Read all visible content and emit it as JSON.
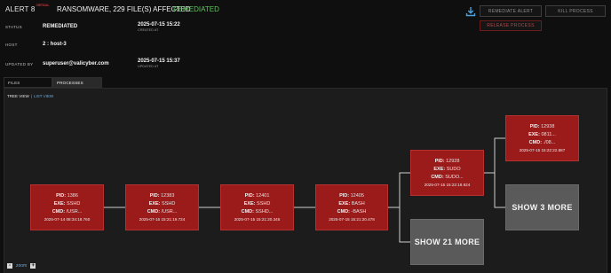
{
  "alert": {
    "id": "ALERT 8",
    "severity": "CRITICAL",
    "title": "RANSOMWARE, 229 FILE(S) AFFECTED",
    "status": "REMEDIATED"
  },
  "details": {
    "status_label": "STATUS",
    "status_value": "REMEDIATED",
    "created_value": "2025-07-15 15:22",
    "created_label": "CREATED AT",
    "host_label": "HOST",
    "host_value": "2 : host-3",
    "updated_by_label": "UPDATED BY",
    "updated_by_value": "superuser@valicyber.com",
    "updated_value": "2025-07-15 15:37",
    "updated_label": "UPDATED AT"
  },
  "toolbar": {
    "download_icon": "download-icon",
    "remediate_label": "REMEDIATE ALERT",
    "kill_label": "KILL PROCESS",
    "release_label": "RELEASE PROCESS"
  },
  "tabs": [
    {
      "label": "FILES",
      "active": false
    },
    {
      "label": "PROCESSES",
      "active": true
    }
  ],
  "view": {
    "tree": "TREE VIEW",
    "separator": "|",
    "list": "LIST VIEW"
  },
  "keys": {
    "pid": "PID:",
    "exe": "EXE:",
    "cmd": "CMD:"
  },
  "nodes": [
    {
      "pid": "1386",
      "exe": "SSHD",
      "cmd": "/USR...",
      "ts": "2025-07-14 08:34:18.760"
    },
    {
      "pid": "12383",
      "exe": "SSHD",
      "cmd": "/USR...",
      "ts": "2025-07-15 15:21:19.724"
    },
    {
      "pid": "12401",
      "exe": "SSHD",
      "cmd": "SSHD...",
      "ts": "2025-07-15 15:21:20.345"
    },
    {
      "pid": "12405",
      "exe": "BASH",
      "cmd": "-BASH",
      "ts": "2025-07-15 15:21:20.478"
    },
    {
      "pid": "12928",
      "exe": "SUDO",
      "cmd": "SUDO...",
      "ts": "2025-07-15 15:22:18.924"
    },
    {
      "pid": "12938",
      "exe": "0811...",
      "cmd": "./08...",
      "ts": "2025-07-15 15:22:22.887"
    }
  ],
  "more": {
    "a": "SHOW 3 MORE",
    "b": "SHOW 21 MORE"
  },
  "zoom": {
    "minus": "-",
    "label": "zoom",
    "plus": "+"
  },
  "colors": {
    "node": "#9b1a1a",
    "more": "#5a5a5a",
    "status": "#5cc85c",
    "link": "#6fa8d6"
  }
}
